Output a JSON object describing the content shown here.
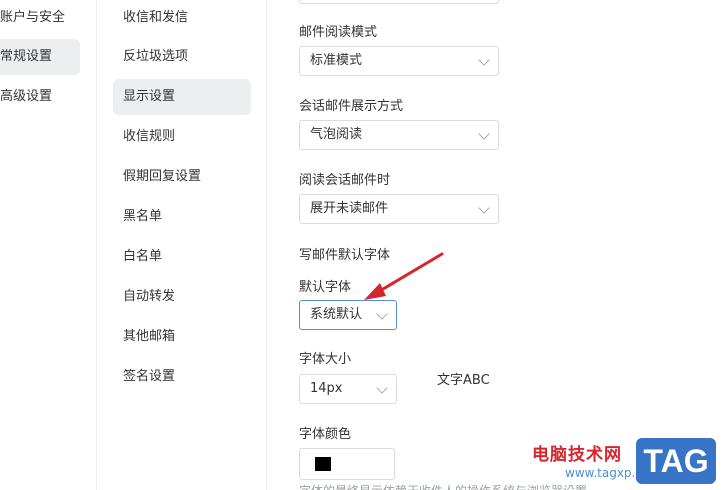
{
  "left_nav": {
    "items": [
      {
        "label": "账户与安全",
        "active": false
      },
      {
        "label": "常规设置",
        "active": true
      },
      {
        "label": "高级设置",
        "active": false
      }
    ]
  },
  "settings_menu": {
    "items": [
      {
        "label": "收信和发信",
        "active": false
      },
      {
        "label": "反垃圾选项",
        "active": false
      },
      {
        "label": "显示设置",
        "active": true
      },
      {
        "label": "收信规则",
        "active": false
      },
      {
        "label": "假期回复设置",
        "active": false
      },
      {
        "label": "黑名单",
        "active": false
      },
      {
        "label": "白名单",
        "active": false
      },
      {
        "label": "自动转发",
        "active": false
      },
      {
        "label": "其他邮箱",
        "active": false
      },
      {
        "label": "签名设置",
        "active": false
      }
    ]
  },
  "content": {
    "read_mode": {
      "label": "邮件阅读模式",
      "value": "标准模式"
    },
    "conversation_display": {
      "label": "会话邮件展示方式",
      "value": "气泡阅读"
    },
    "conversation_read": {
      "label": "阅读会话邮件时",
      "value": "展开未读邮件"
    },
    "compose_font": {
      "section_label": "写邮件默认字体",
      "default_font": {
        "label": "默认字体",
        "value": "系统默认"
      },
      "font_size": {
        "label": "字体大小",
        "value": "14px"
      },
      "preview_text": "文字ABC",
      "font_color": {
        "label": "字体颜色",
        "value": "#000000"
      },
      "note": "字体的最终显示依赖于收件人的操作系统与浏览器设置"
    }
  },
  "colors": {
    "accent_arrow": "#d4262c",
    "focus_border": "#5a8cdc"
  },
  "watermark": {
    "site_name": "电脑技术网",
    "url": "www.tagxp.com",
    "badge": "TAG"
  }
}
